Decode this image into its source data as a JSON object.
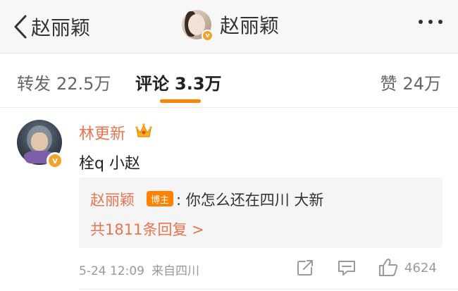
{
  "header": {
    "back_label": "赵丽颖",
    "title": "赵丽颖",
    "verified_mark": "v"
  },
  "tabs": [
    {
      "label": "转发",
      "count": "22.5万"
    },
    {
      "label": "评论",
      "count": "3.3万"
    },
    {
      "label": "赞",
      "count": "24万"
    }
  ],
  "active_tab_color": "#ff8200",
  "comment": {
    "username": "林更新",
    "verified_mark": "v",
    "text": "栓q 小赵",
    "reply": {
      "author": "赵丽颖",
      "badge": "博主",
      "text": ": 你怎么还在四川 大新",
      "more_label": "共1811条回复 >"
    },
    "time": "5-24 12:09",
    "source": "来自四川",
    "like_count": "4624"
  },
  "icons": {
    "back": "chevron-left-icon",
    "more": "more-dots-icon",
    "crown": "crown-icon",
    "share": "share-icon",
    "comment": "comment-icon",
    "like": "thumbs-up-icon"
  },
  "colors": {
    "username": "#eb7350",
    "badge": "#ff8200",
    "verified": "#f2a12a"
  }
}
